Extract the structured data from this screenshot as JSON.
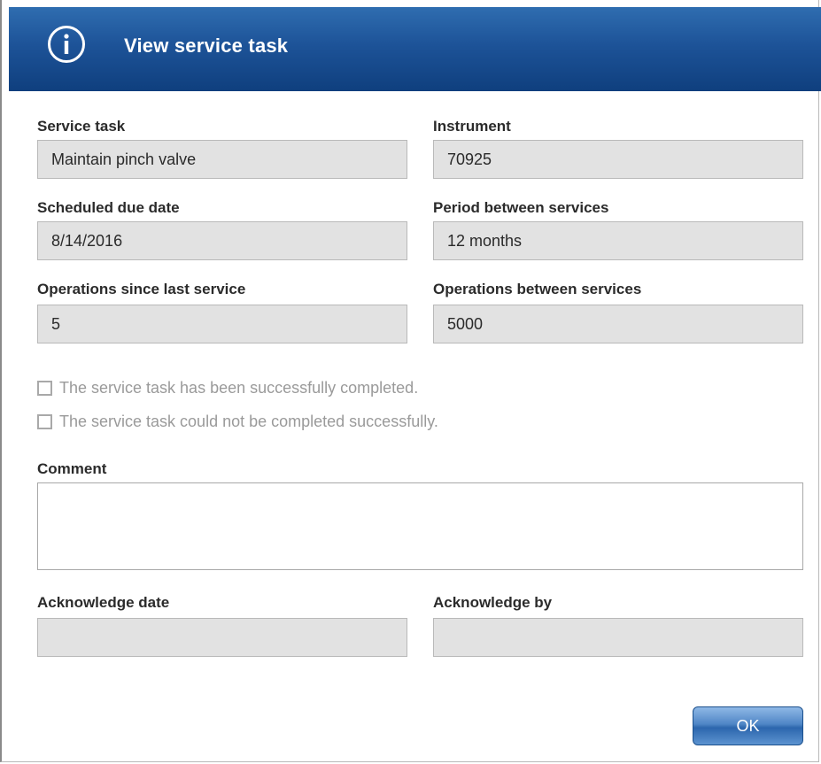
{
  "dialog": {
    "title": "View service task",
    "icon": "info-icon"
  },
  "fields": {
    "service_task": {
      "label": "Service task",
      "value": "Maintain pinch valve"
    },
    "instrument": {
      "label": "Instrument",
      "value": "70925"
    },
    "scheduled_due_date": {
      "label": "Scheduled due date",
      "value": "8/14/2016"
    },
    "period_between_services": {
      "label": "Period between services",
      "value": "12 months"
    },
    "operations_since_last_service": {
      "label": "Operations since last service",
      "value": "5"
    },
    "operations_between_services": {
      "label": "Operations between services",
      "value": "5000"
    },
    "acknowledge_date": {
      "label": "Acknowledge date",
      "value": ""
    },
    "acknowledge_by": {
      "label": "Acknowledge by",
      "value": ""
    }
  },
  "checkboxes": {
    "completed": {
      "label": "The service task has been successfully completed.",
      "checked": false
    },
    "not_completed": {
      "label": "The service task could not be completed successfully.",
      "checked": false
    }
  },
  "comment": {
    "label": "Comment",
    "value": ""
  },
  "buttons": {
    "ok_label": "OK"
  },
  "colors": {
    "titlebar_top": "#2f6db0",
    "titlebar_bottom": "#0f3f7e",
    "field_background": "#e2e2e2",
    "disabled_text": "#9a9a9a"
  }
}
